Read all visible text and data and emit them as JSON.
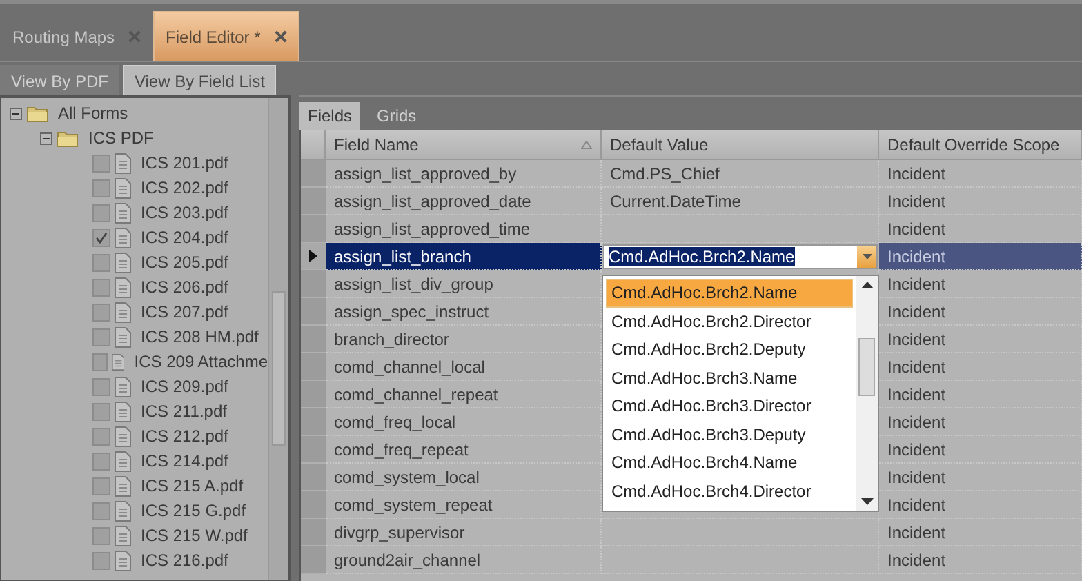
{
  "tabs": [
    {
      "label": "Routing Maps",
      "selected": false
    },
    {
      "label": "Field Editor *",
      "selected": true
    }
  ],
  "view_tabs": [
    {
      "label": "View By PDF",
      "selected": false
    },
    {
      "label": "View By Field List",
      "selected": true
    }
  ],
  "tree": [
    {
      "label": "All Forms",
      "expanded": true,
      "children": [
        {
          "label": "ICS PDF",
          "expanded": true,
          "children": [
            {
              "label": "ICS 201.pdf",
              "checked": false
            },
            {
              "label": "ICS 202.pdf",
              "checked": false
            },
            {
              "label": "ICS 203.pdf",
              "checked": false
            },
            {
              "label": "ICS 204.pdf",
              "checked": true
            },
            {
              "label": "ICS 205.pdf",
              "checked": false
            },
            {
              "label": "ICS 206.pdf",
              "checked": false
            },
            {
              "label": "ICS 207.pdf",
              "checked": false
            },
            {
              "label": "ICS 208 HM.pdf",
              "checked": false
            },
            {
              "label": "ICS 209 Attachme",
              "checked": false
            },
            {
              "label": "ICS 209.pdf",
              "checked": false
            },
            {
              "label": "ICS 211.pdf",
              "checked": false
            },
            {
              "label": "ICS 212.pdf",
              "checked": false
            },
            {
              "label": "ICS 214.pdf",
              "checked": false
            },
            {
              "label": "ICS 215 A.pdf",
              "checked": false
            },
            {
              "label": "ICS 215 G.pdf",
              "checked": false
            },
            {
              "label": "ICS 215 W.pdf",
              "checked": false
            },
            {
              "label": "ICS 216.pdf",
              "checked": false
            }
          ]
        }
      ]
    }
  ],
  "grid_tabs": [
    {
      "label": "Fields",
      "selected": true
    },
    {
      "label": "Grids",
      "selected": false
    }
  ],
  "table": {
    "columns": [
      "Field Name",
      "Default Value",
      "Default Override Scope"
    ],
    "rows": [
      {
        "field_name": "assign_list_approved_by",
        "default_value": "Cmd.PS_Chief",
        "scope": "Incident",
        "selected": false
      },
      {
        "field_name": "assign_list_approved_date",
        "default_value": "Current.DateTime",
        "scope": "Incident",
        "selected": false
      },
      {
        "field_name": "assign_list_approved_time",
        "scope": "Incident",
        "selected": false
      },
      {
        "field_name": "assign_list_branch",
        "default_value": "Cmd.AdHoc.Brch2.Name",
        "scope": "Incident",
        "selected": true
      },
      {
        "field_name": "assign_list_div_group",
        "scope": "Incident",
        "selected": false
      },
      {
        "field_name": "assign_spec_instruct",
        "scope": "Incident",
        "selected": false
      },
      {
        "field_name": "branch_director",
        "scope": "Incident",
        "selected": false
      },
      {
        "field_name": "comd_channel_local",
        "scope": "Incident",
        "selected": false
      },
      {
        "field_name": "comd_channel_repeat",
        "scope": "Incident",
        "selected": false
      },
      {
        "field_name": "comd_freq_local",
        "scope": "Incident",
        "selected": false
      },
      {
        "field_name": "comd_freq_repeat",
        "scope": "Incident",
        "selected": false
      },
      {
        "field_name": "comd_system_local",
        "scope": "Incident",
        "selected": false
      },
      {
        "field_name": "comd_system_repeat",
        "scope": "Incident",
        "selected": false
      },
      {
        "field_name": "divgrp_supervisor",
        "scope": "Incident",
        "selected": false
      },
      {
        "field_name": "ground2air_channel",
        "scope": "Incident",
        "selected": false
      }
    ]
  },
  "dropdown": {
    "items": [
      {
        "label": "Cmd.AdHoc.Brch2.Name",
        "selected": true
      },
      {
        "label": "Cmd.AdHoc.Brch2.Director",
        "selected": false
      },
      {
        "label": "Cmd.AdHoc.Brch2.Deputy",
        "selected": false
      },
      {
        "label": "Cmd.AdHoc.Brch3.Name",
        "selected": false
      },
      {
        "label": "Cmd.AdHoc.Brch3.Director",
        "selected": false
      },
      {
        "label": "Cmd.AdHoc.Brch3.Deputy",
        "selected": false
      },
      {
        "label": "Cmd.AdHoc.Brch4.Name",
        "selected": false
      },
      {
        "label": "Cmd.AdHoc.Brch4.Director",
        "selected": false
      }
    ]
  }
}
